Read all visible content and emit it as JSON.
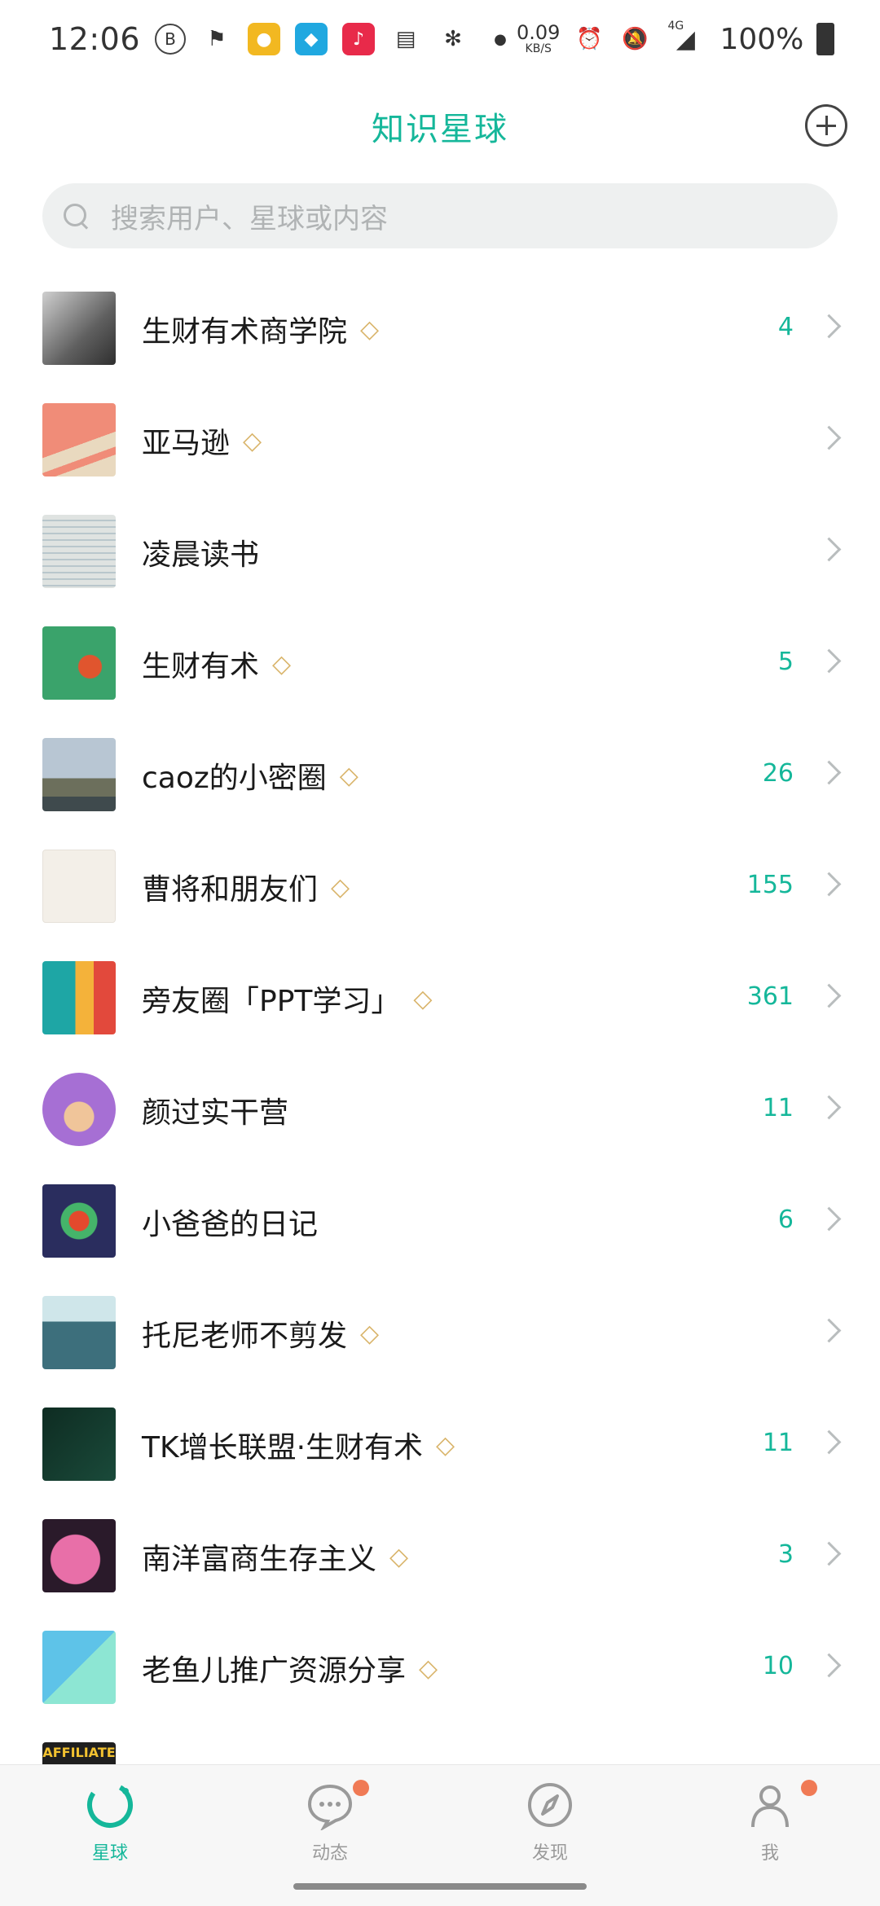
{
  "status_bar": {
    "time": "12:06",
    "net_speed_value": "0.09",
    "net_speed_unit": "KB/S",
    "signal_label": "4G",
    "battery": "100%"
  },
  "header": {
    "title": "知识星球"
  },
  "search": {
    "placeholder": "搜索用户、星球或内容"
  },
  "list": {
    "items": [
      {
        "name": "生财有术商学院",
        "diamond": true,
        "count": "4"
      },
      {
        "name": "亚马逊",
        "diamond": true,
        "count": ""
      },
      {
        "name": "凌晨读书",
        "diamond": false,
        "count": ""
      },
      {
        "name": "生财有术",
        "diamond": true,
        "count": "5"
      },
      {
        "name": "caoz的小密圈",
        "diamond": true,
        "count": "26"
      },
      {
        "name": "曹将和朋友们",
        "diamond": true,
        "count": "155"
      },
      {
        "name": "旁友圈「PPT学习」",
        "diamond": true,
        "count": "361"
      },
      {
        "name": "颜过实干营",
        "diamond": false,
        "count": "11"
      },
      {
        "name": "小爸爸的日记",
        "diamond": false,
        "count": "6"
      },
      {
        "name": "托尼老师不剪发",
        "diamond": true,
        "count": ""
      },
      {
        "name": "TK增长联盟·生财有术",
        "diamond": true,
        "count": "11"
      },
      {
        "name": "南洋富商生存主义",
        "diamond": true,
        "count": "3"
      },
      {
        "name": "老鱼儿推广资源分享",
        "diamond": true,
        "count": "10"
      }
    ],
    "partial_avatar_text": "AFFILIATE"
  },
  "bottom_nav": {
    "items": [
      {
        "label": "星球",
        "active": true
      },
      {
        "label": "动态",
        "active": false
      },
      {
        "label": "发现",
        "active": false
      },
      {
        "label": "我",
        "active": false
      }
    ]
  },
  "colors": {
    "accent": "#15b79a",
    "diamond": "#d9b46a",
    "badge": "#f07a55"
  }
}
